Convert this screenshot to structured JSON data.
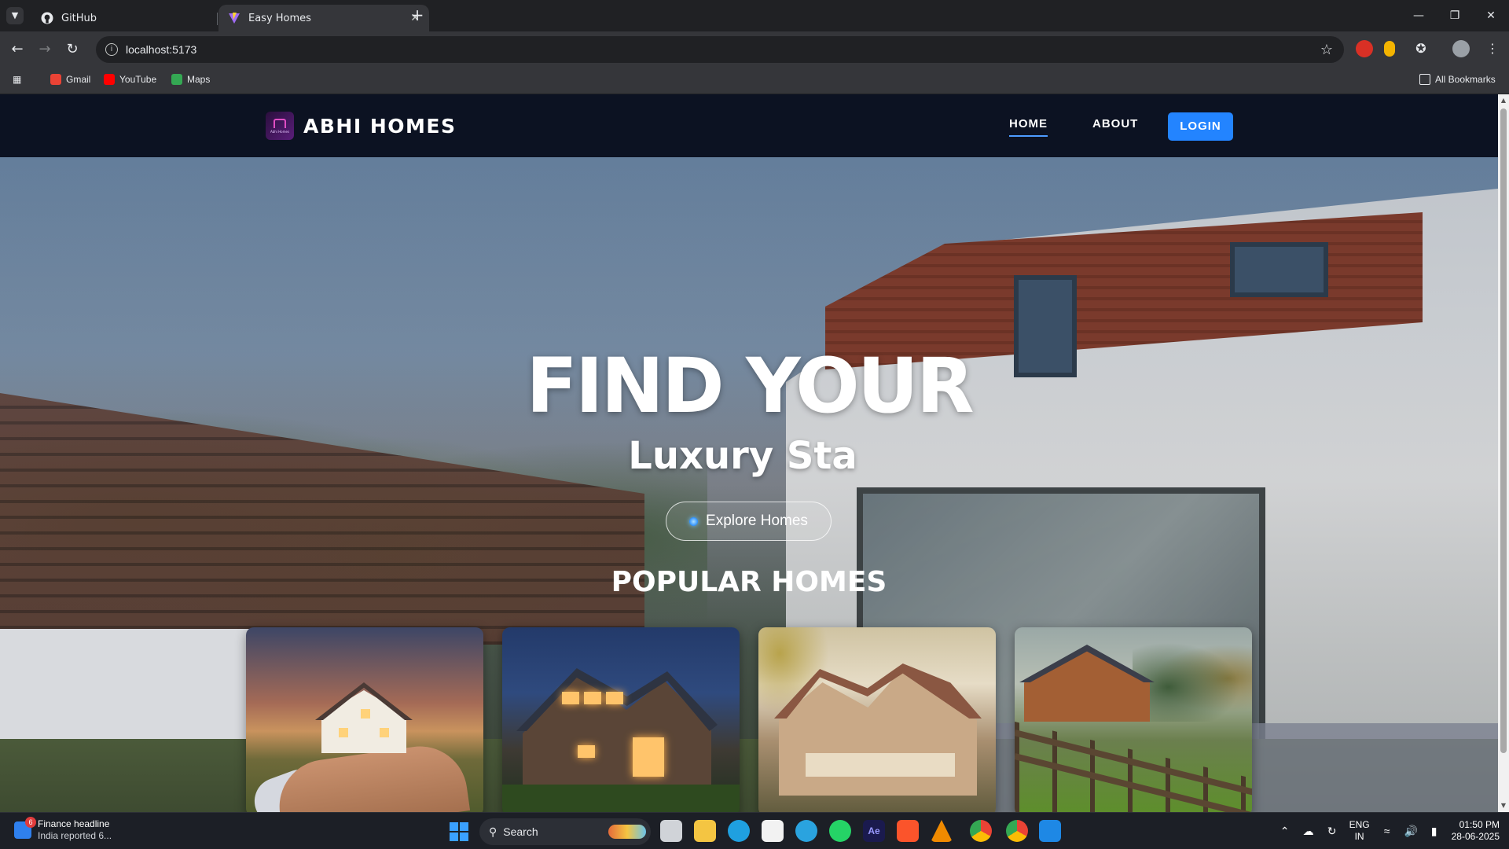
{
  "browser": {
    "tabs": [
      {
        "title": "GitHub",
        "active": false,
        "icon": "github-icon"
      },
      {
        "title": "Easy Homes",
        "active": true,
        "icon": "vite-icon"
      }
    ],
    "url": "localhost:5173",
    "bookmarks": [
      {
        "label": "Gmail",
        "icon": "gmail-icon",
        "color": "#ea4335"
      },
      {
        "label": "YouTube",
        "icon": "youtube-icon",
        "color": "#ff0000"
      },
      {
        "label": "Maps",
        "icon": "maps-icon",
        "color": "#34a853"
      }
    ],
    "all_bookmarks_label": "All Bookmarks"
  },
  "site": {
    "brand": {
      "name": "ABHI HOMES",
      "logo_text": "Abhi Homes"
    },
    "nav": {
      "home": "HOME",
      "about": "ABOUT",
      "login": "LOGIN"
    },
    "hero": {
      "title": "FIND YOUR",
      "subtitle": "Luxury Sta",
      "cta": "Explore Homes"
    },
    "popular": {
      "heading": "POPULAR HOMES",
      "cards": [
        {
          "name": "house-in-hand-card"
        },
        {
          "name": "night-cabin-card"
        },
        {
          "name": "victorian-house-card"
        },
        {
          "name": "farmhouse-card"
        }
      ]
    },
    "colors": {
      "nav_bg": "#0c1222",
      "accent": "#2384ff"
    }
  },
  "taskbar": {
    "widget": {
      "title": "Finance headline",
      "subtitle": "India reported 6...",
      "badge": "6"
    },
    "search_placeholder": "Search",
    "apps": [
      {
        "name": "task-view-icon"
      },
      {
        "name": "file-explorer-icon"
      },
      {
        "name": "edge-icon"
      },
      {
        "name": "ms-store-icon"
      },
      {
        "name": "telegram-icon"
      },
      {
        "name": "whatsapp-icon"
      },
      {
        "name": "after-effects-icon",
        "label": "Ae"
      },
      {
        "name": "brave-icon"
      },
      {
        "name": "vlc-icon"
      },
      {
        "name": "chrome-icon"
      },
      {
        "name": "chrome-profile-icon"
      },
      {
        "name": "vscode-icon"
      }
    ],
    "lang": {
      "line1": "ENG",
      "line2": "IN"
    },
    "time": "01:50 PM",
    "date": "28-06-2025"
  }
}
